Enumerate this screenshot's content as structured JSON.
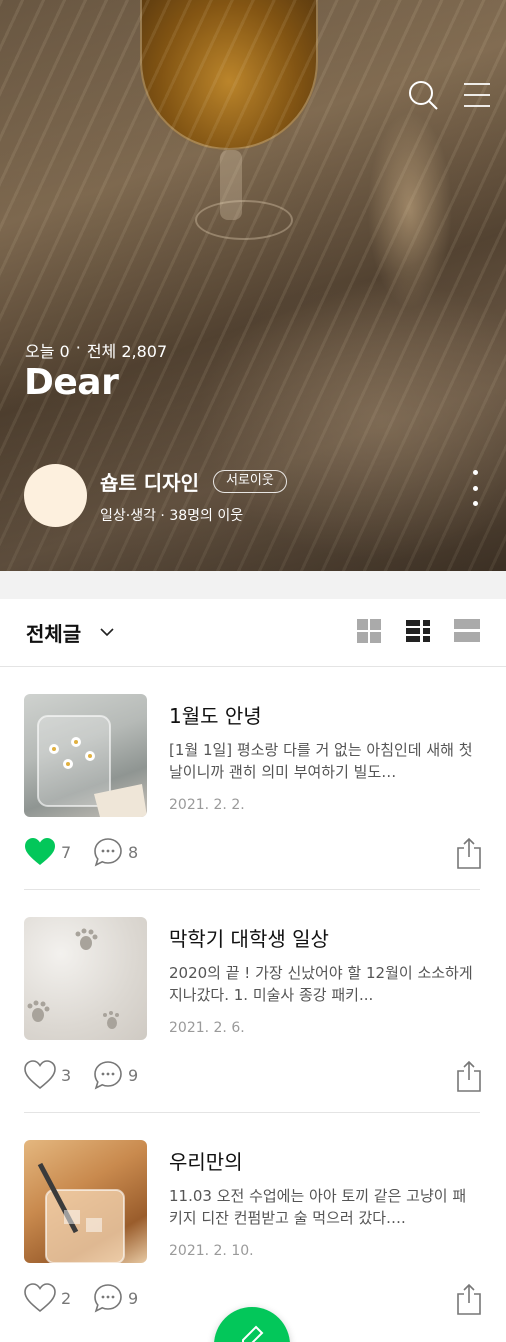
{
  "header": {
    "visits_today": "오늘 0",
    "separator": "·",
    "visits_total": "전체 2,807",
    "blog_title": "Dear"
  },
  "profile": {
    "nickname": "숍트 디자인",
    "badge": "서로이웃",
    "subtitle": "일상·생각 · 38명의 이웃"
  },
  "toolbar": {
    "category": "전체글",
    "views": [
      "grid",
      "list",
      "card"
    ]
  },
  "posts": [
    {
      "title": "1월도 안녕",
      "excerpt": "[1월 1일] 평소랑 다를 거 없는 아침인데 새해 첫날이니까 괜히 의미 부여하기 빌도…",
      "date": "2021. 2. 2.",
      "likes": "7",
      "liked": true,
      "comments": "8"
    },
    {
      "title": "막학기 대학생 일상",
      "excerpt": "2020의 끝 ! 가장 신났어야 할 12월이 소소하게 지나갔다. 1. 미술사 종강 패키...",
      "date": "2021. 2. 6.",
      "likes": "3",
      "liked": false,
      "comments": "9"
    },
    {
      "title": "우리만의",
      "excerpt": "11.03 오전 수업에는 아아 토끼 같은 고냥이 패키지 디잔 컨펌받고 술 먹으러 갔다….",
      "date": "2021. 2. 10.",
      "likes": "2",
      "liked": false,
      "comments": "9"
    }
  ],
  "colors": {
    "accent": "#03c75a",
    "like_active": "#03c75a",
    "text_muted": "#9a9a9a"
  },
  "icons": [
    "search-icon",
    "menu-icon",
    "more-icon",
    "chevron-down-icon",
    "grid-view-icon",
    "list-view-icon",
    "card-view-icon",
    "heart-icon",
    "comment-icon",
    "share-icon",
    "pencil-icon"
  ]
}
